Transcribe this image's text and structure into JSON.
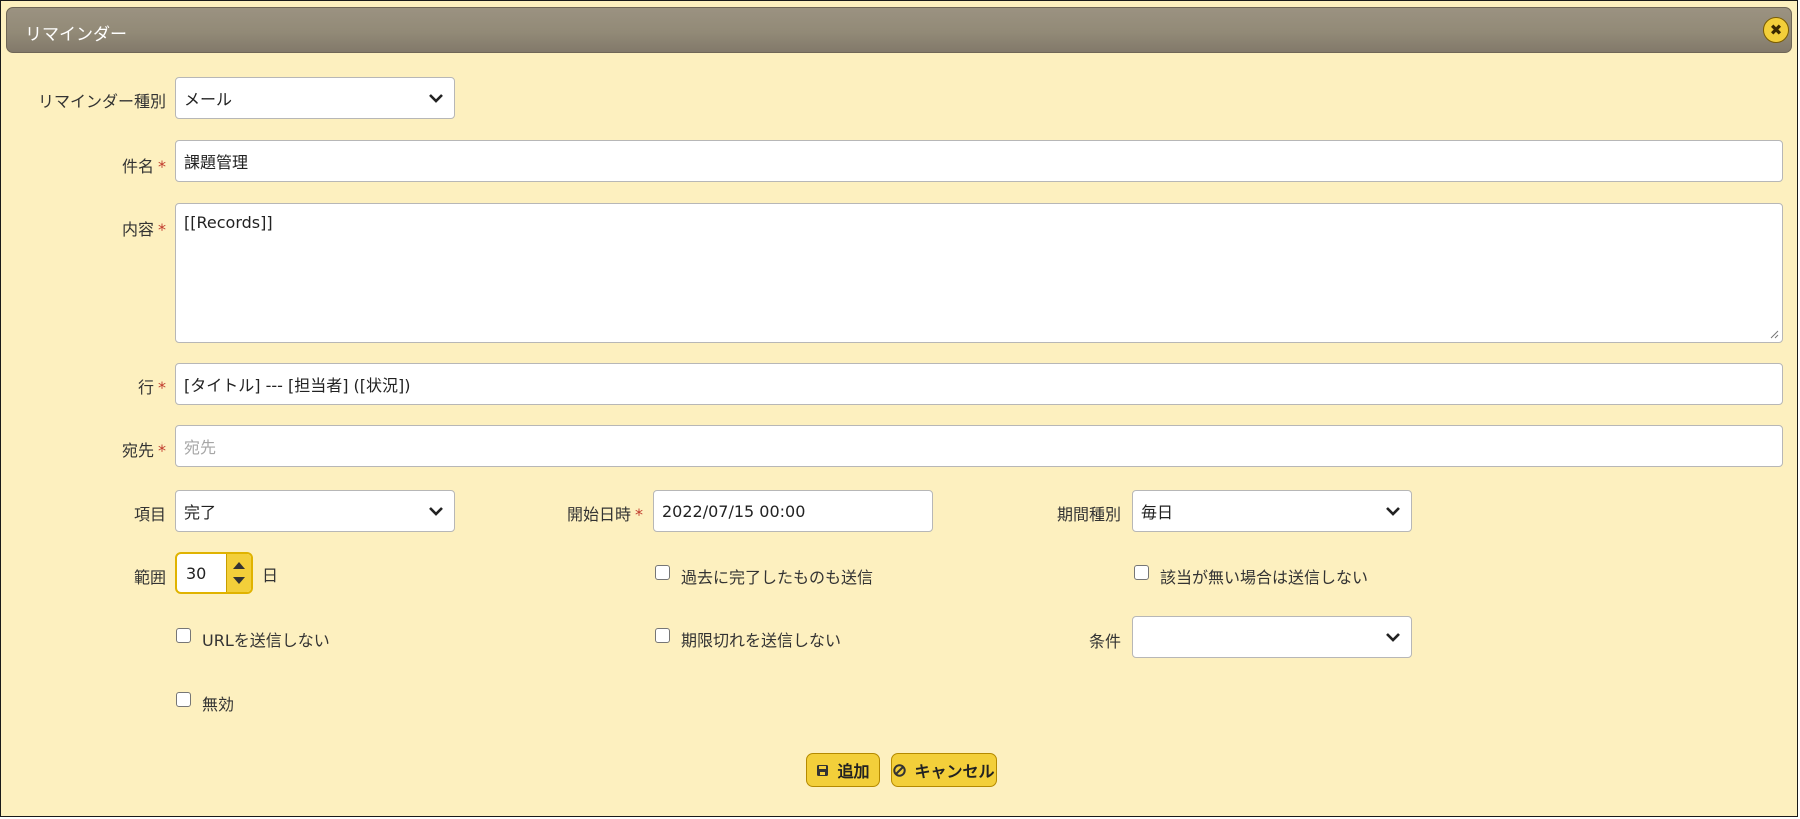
{
  "window": {
    "title": "リマインダー",
    "close_icon": "close-icon"
  },
  "form": {
    "reminder_type": {
      "label": "リマインダー種別",
      "value": "メール"
    },
    "subject": {
      "label": "件名",
      "required_mark": "*",
      "value": "課題管理"
    },
    "content": {
      "label": "内容",
      "required_mark": "*",
      "value": "[[Records]]"
    },
    "line": {
      "label": "行",
      "required_mark": "*",
      "value": "[タイトル] --- [担当者] ([状況])"
    },
    "to": {
      "label": "宛先",
      "required_mark": "*",
      "value": "",
      "placeholder": "宛先"
    },
    "item": {
      "label": "項目",
      "value": "完了"
    },
    "start_datetime": {
      "label": "開始日時",
      "required_mark": "*",
      "value": "2022/07/15 00:00"
    },
    "period_type": {
      "label": "期間種別",
      "value": "毎日"
    },
    "range": {
      "label": "範囲",
      "value": "30",
      "unit": "日"
    },
    "send_completed_past": {
      "label": "過去に完了したものも送信",
      "checked": false
    },
    "no_send_if_none": {
      "label": "該当が無い場合は送信しない",
      "checked": false
    },
    "no_send_url": {
      "label": "URLを送信しない",
      "checked": false
    },
    "no_send_expired": {
      "label": "期限切れを送信しない",
      "checked": false
    },
    "condition": {
      "label": "条件",
      "value": ""
    },
    "disabled": {
      "label": "無効",
      "checked": false
    }
  },
  "buttons": {
    "add": "追加",
    "cancel": "キャンセル"
  },
  "colors": {
    "dialog_bg": "#fdf0bf",
    "titlebar": "#928a77",
    "accent": "#f3cf3a",
    "required": "#c0392b"
  }
}
